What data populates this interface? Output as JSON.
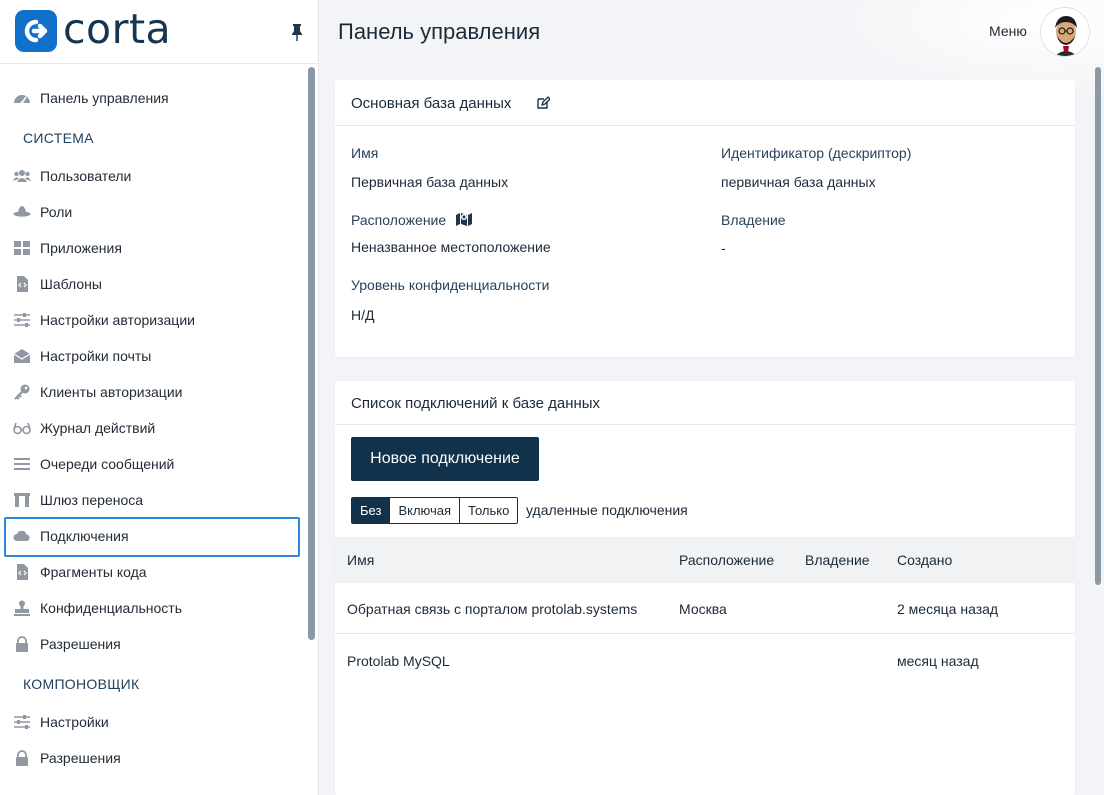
{
  "app": {
    "logo_text": "corta",
    "page_title": "Панель управления",
    "menu_label": "Меню"
  },
  "sidebar": {
    "items": [
      {
        "type": "item",
        "label": "Панель управления",
        "icon": "dashboard-icon"
      },
      {
        "type": "section",
        "label": "СИСТЕМА"
      },
      {
        "type": "item",
        "label": "Пользователи",
        "icon": "users-icon"
      },
      {
        "type": "item",
        "label": "Роли",
        "icon": "hat-icon"
      },
      {
        "type": "item",
        "label": "Приложения",
        "icon": "apps-grid-icon"
      },
      {
        "type": "item",
        "label": "Шаблоны",
        "icon": "code-file-icon"
      },
      {
        "type": "item",
        "label": "Настройки авторизации",
        "icon": "sliders-icon"
      },
      {
        "type": "item",
        "label": "Настройки почты",
        "icon": "envelope-icon"
      },
      {
        "type": "item",
        "label": "Клиенты авторизации",
        "icon": "key-icon"
      },
      {
        "type": "item",
        "label": "Журнал действий",
        "icon": "glasses-icon"
      },
      {
        "type": "item",
        "label": "Очереди сообщений",
        "icon": "lines-icon"
      },
      {
        "type": "item",
        "label": "Шлюз переноса",
        "icon": "gateway-icon"
      },
      {
        "type": "item",
        "label": "Подключения",
        "icon": "cloud-icon",
        "active": true
      },
      {
        "type": "item",
        "label": "Фрагменты кода",
        "icon": "code-file-icon"
      },
      {
        "type": "item",
        "label": "Конфиденциальность",
        "icon": "stamp-icon"
      },
      {
        "type": "item",
        "label": "Разрешения",
        "icon": "lock-icon"
      },
      {
        "type": "section",
        "label": "КОМПОНОВЩИК"
      },
      {
        "type": "item",
        "label": "Настройки",
        "icon": "sliders-icon"
      },
      {
        "type": "item",
        "label": "Разрешения",
        "icon": "lock-icon"
      }
    ]
  },
  "database": {
    "title": "Основная база данных",
    "fields": {
      "name_label": "Имя",
      "name_value": "Первичная база данных",
      "id_label": "Идентификатор (дескриптор)",
      "id_value": "первичная база данных",
      "location_label": "Расположение",
      "location_value": "Неназванное местоположение",
      "owner_label": "Владение",
      "owner_value": "-",
      "privacy_label": "Уровень конфиденциальности",
      "privacy_value": "Н/Д"
    }
  },
  "connections": {
    "title": "Список подключений к базе данных",
    "new_button": "Новое подключение",
    "filter": {
      "options": [
        "Без",
        "Включая",
        "Только"
      ],
      "selected": 0,
      "suffix": "удаленные подключения"
    },
    "columns": [
      "Имя",
      "Расположение",
      "Владение",
      "Создано"
    ],
    "rows": [
      [
        "Обратная связь с порталом protolab.systems",
        "Москва",
        "",
        "2 месяца назад"
      ],
      [
        "Protolab MySQL",
        "",
        "",
        "месяц назад"
      ]
    ]
  },
  "colors": {
    "brand": "#1170c9",
    "navy": "#12324b",
    "focus": "#2a88df"
  }
}
